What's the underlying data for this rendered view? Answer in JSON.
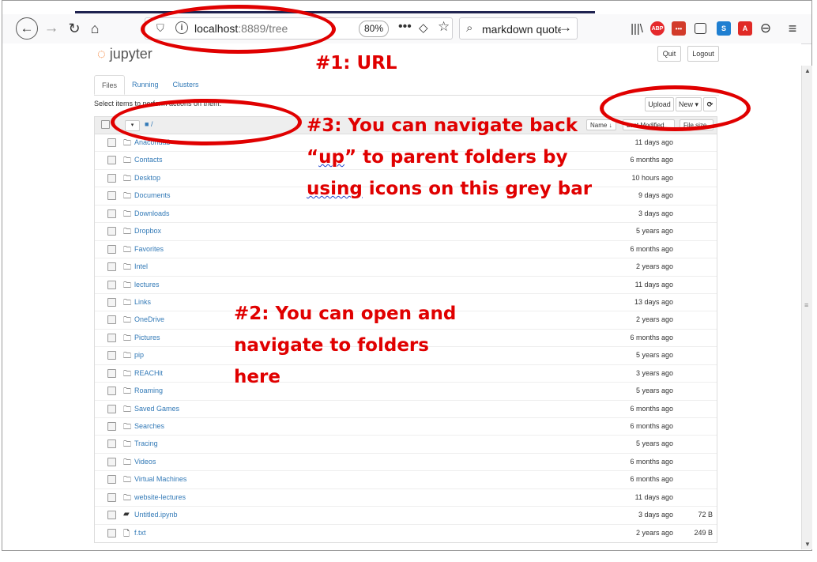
{
  "browser": {
    "url_host": "localhost",
    "url_path": ":8889/tree",
    "zoom": "80%",
    "search_text": "markdown quote l",
    "extensions": [
      {
        "name": "abp-icon",
        "label": "ABP",
        "color": "#e5292c"
      },
      {
        "name": "feed-icon",
        "label": "•••",
        "color": "#d23b2a"
      },
      {
        "name": "sidebar-icon",
        "label": "",
        "color": "#ffffff"
      },
      {
        "name": "s-extension-icon",
        "label": "S",
        "color": "#1f7fd1"
      },
      {
        "name": "pdf-icon",
        "label": "A",
        "color": "#e02a26"
      }
    ]
  },
  "jupyter": {
    "logo_text": "jupyter",
    "quit_label": "Quit",
    "logout_label": "Logout",
    "tabs": [
      "Files",
      "Running",
      "Clusters"
    ],
    "select_text": "Select items to perform actions on them.",
    "upload_label": "Upload",
    "new_label": "New ▾",
    "refresh_label": "⟳",
    "path": "/",
    "col_name": "Name ↓",
    "col_modified": "Last Modified",
    "col_size": "File size"
  },
  "files": [
    {
      "icon": "folder",
      "name": "Anaconda3",
      "modified": "11 days ago",
      "size": ""
    },
    {
      "icon": "folder",
      "name": "Contacts",
      "modified": "6 months ago",
      "size": ""
    },
    {
      "icon": "folder",
      "name": "Desktop",
      "modified": "10 hours ago",
      "size": ""
    },
    {
      "icon": "folder",
      "name": "Documents",
      "modified": "9 days ago",
      "size": ""
    },
    {
      "icon": "folder",
      "name": "Downloads",
      "modified": "3 days ago",
      "size": ""
    },
    {
      "icon": "folder",
      "name": "Dropbox",
      "modified": "5 years ago",
      "size": ""
    },
    {
      "icon": "folder",
      "name": "Favorites",
      "modified": "6 months ago",
      "size": ""
    },
    {
      "icon": "folder",
      "name": "Intel",
      "modified": "2 years ago",
      "size": ""
    },
    {
      "icon": "folder",
      "name": "lectures",
      "modified": "11 days ago",
      "size": ""
    },
    {
      "icon": "folder",
      "name": "Links",
      "modified": "13 days ago",
      "size": ""
    },
    {
      "icon": "folder",
      "name": "OneDrive",
      "modified": "2 years ago",
      "size": ""
    },
    {
      "icon": "folder",
      "name": "Pictures",
      "modified": "6 months ago",
      "size": ""
    },
    {
      "icon": "folder",
      "name": "pip",
      "modified": "5 years ago",
      "size": ""
    },
    {
      "icon": "folder",
      "name": "REACHit",
      "modified": "3 years ago",
      "size": ""
    },
    {
      "icon": "folder",
      "name": "Roaming",
      "modified": "5 years ago",
      "size": ""
    },
    {
      "icon": "folder",
      "name": "Saved Games",
      "modified": "6 months ago",
      "size": ""
    },
    {
      "icon": "folder",
      "name": "Searches",
      "modified": "6 months ago",
      "size": ""
    },
    {
      "icon": "folder",
      "name": "Tracing",
      "modified": "5 years ago",
      "size": ""
    },
    {
      "icon": "folder",
      "name": "Videos",
      "modified": "6 months ago",
      "size": ""
    },
    {
      "icon": "folder",
      "name": "Virtual Machines",
      "modified": "6 months ago",
      "size": ""
    },
    {
      "icon": "folder",
      "name": "website-lectures",
      "modified": "11 days ago",
      "size": ""
    },
    {
      "icon": "notebook",
      "name": "Untitled.ipynb",
      "modified": "3 days ago",
      "size": "72 B"
    },
    {
      "icon": "file",
      "name": "f.txt",
      "modified": "2 years ago",
      "size": "249 B"
    }
  ],
  "annotations": {
    "a1": "#1: URL",
    "a2_line1": "#2: You can open and",
    "a2_line2": "navigate to folders",
    "a2_line3": "here",
    "a3_line1": "#3: You can navigate back",
    "a3_line2_pre": "“",
    "a3_line2_up": "up",
    "a3_line2_post": "” to parent folders by",
    "a3_line3_using": "using",
    "a3_line3_rest": " icons on this grey bar"
  }
}
